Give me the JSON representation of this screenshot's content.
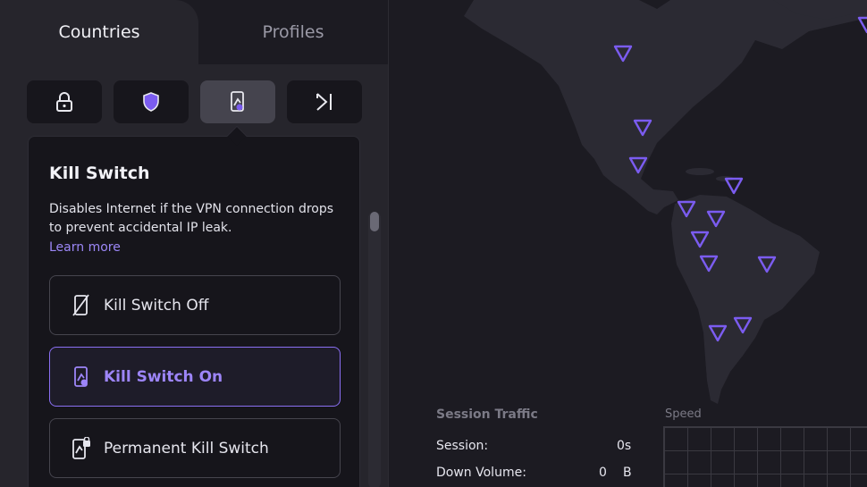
{
  "tabs": {
    "countries": "Countries",
    "profiles": "Profiles"
  },
  "feature_buttons": [
    {
      "icon": "lock-icon",
      "active": false
    },
    {
      "icon": "shield-icon",
      "active": false
    },
    {
      "icon": "kill-switch-icon",
      "active": true
    },
    {
      "icon": "exit-arrow-icon",
      "active": false
    }
  ],
  "kill_switch": {
    "title": "Kill Switch",
    "description": "Disables Internet if the VPN connection drops to prevent accidental IP leak.",
    "learn_more": "Learn more",
    "options": [
      {
        "label": "Kill Switch Off",
        "icon": "kill-switch-off-icon",
        "selected": false
      },
      {
        "label": "Kill Switch On",
        "icon": "kill-switch-on-icon",
        "selected": true
      },
      {
        "label": "Permanent Kill Switch",
        "icon": "permanent-kill-switch-icon",
        "selected": false
      }
    ]
  },
  "session_traffic": {
    "title": "Session Traffic",
    "session_label": "Session:",
    "session_value": "0s",
    "down_label": "Down Volume:",
    "down_value": "0",
    "down_unit": "B"
  },
  "speed": {
    "title": "Speed"
  },
  "colors": {
    "accent": "#8a6ff2",
    "marker": "#7b5cf0",
    "land": "#2b2a33",
    "background": "#1c1b22"
  }
}
